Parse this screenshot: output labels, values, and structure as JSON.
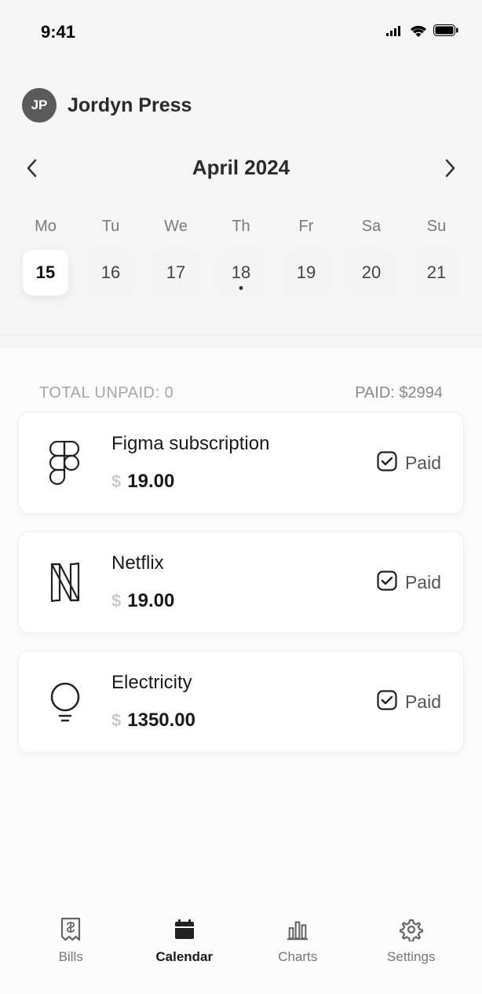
{
  "status": {
    "time": "9:41"
  },
  "profile": {
    "initials": "JP",
    "name": "Jordyn Press"
  },
  "month": {
    "title": "April 2024"
  },
  "week": {
    "days": [
      {
        "abbr": "Mo",
        "num": "15",
        "selected": true,
        "dot": false
      },
      {
        "abbr": "Tu",
        "num": "16",
        "selected": false,
        "dot": false
      },
      {
        "abbr": "We",
        "num": "17",
        "selected": false,
        "dot": false
      },
      {
        "abbr": "Th",
        "num": "18",
        "selected": false,
        "dot": true
      },
      {
        "abbr": "Fr",
        "num": "19",
        "selected": false,
        "dot": false
      },
      {
        "abbr": "Sa",
        "num": "20",
        "selected": false,
        "dot": false
      },
      {
        "abbr": "Su",
        "num": "21",
        "selected": false,
        "dot": false
      }
    ]
  },
  "totals": {
    "unpaid_label": "TOTAL UNPAID: 0",
    "paid_label": "PAID: $2994"
  },
  "bills": [
    {
      "icon": "figma",
      "name": "Figma subscription",
      "currency": "$",
      "amount": "19.00",
      "status": "Paid"
    },
    {
      "icon": "netflix",
      "name": "Netflix",
      "currency": "$",
      "amount": "19.00",
      "status": "Paid"
    },
    {
      "icon": "bulb",
      "name": "Electricity",
      "currency": "$",
      "amount": "1350.00",
      "status": "Paid"
    }
  ],
  "nav": {
    "items": [
      {
        "label": "Bills",
        "active": false
      },
      {
        "label": "Calendar",
        "active": true
      },
      {
        "label": "Charts",
        "active": false
      },
      {
        "label": "Settings",
        "active": false
      }
    ]
  }
}
